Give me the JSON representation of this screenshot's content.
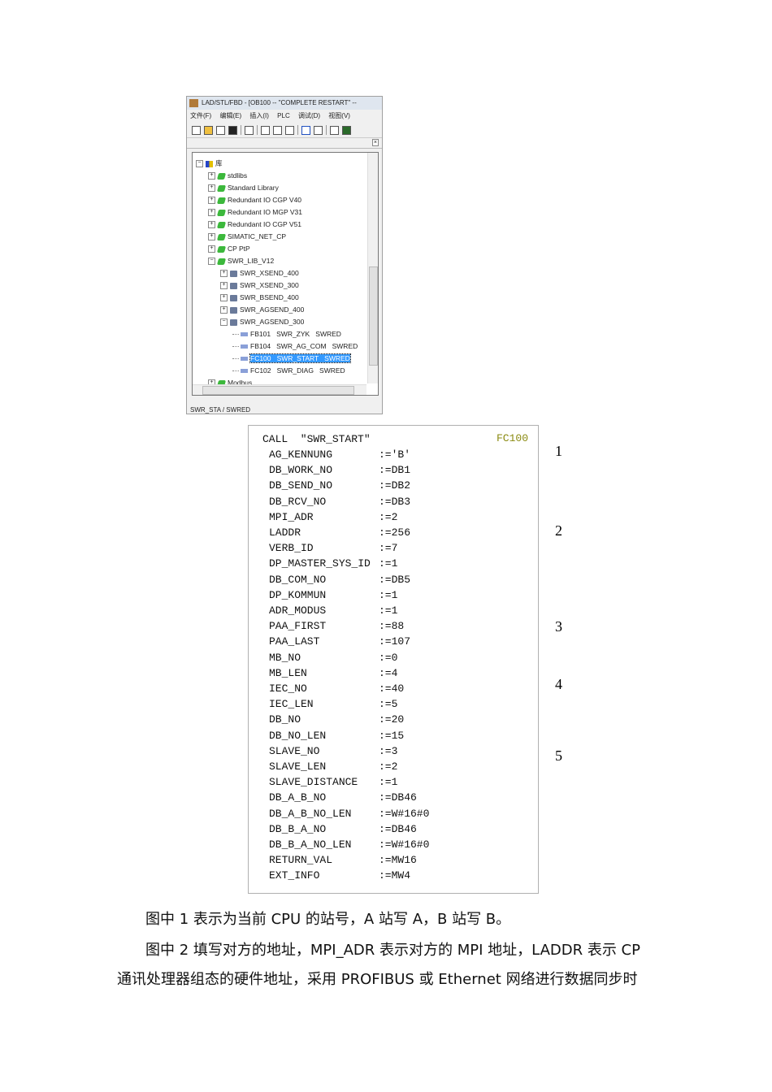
{
  "screenshot": {
    "title": "LAD/STL/FBD  - [OB100 -- \"COMPLETE RESTART\" --",
    "menu": [
      "文件(F)",
      "编辑(E)",
      "插入(I)",
      "PLC",
      "调试(D)",
      "视图(V)"
    ],
    "tree": [
      {
        "label": "库",
        "depth": 0,
        "icon": "book",
        "exp": "−"
      },
      {
        "label": "stdlibs",
        "depth": 1,
        "icon": "lib",
        "exp": "+"
      },
      {
        "label": "Standard Library",
        "depth": 1,
        "icon": "lib",
        "exp": "+"
      },
      {
        "label": "Redundant IO CGP V40",
        "depth": 1,
        "icon": "lib",
        "exp": "+"
      },
      {
        "label": "Redundant IO MGP V31",
        "depth": 1,
        "icon": "lib",
        "exp": "+"
      },
      {
        "label": "Redundant IO CGP V51",
        "depth": 1,
        "icon": "lib",
        "exp": "+"
      },
      {
        "label": "SIMATIC_NET_CP",
        "depth": 1,
        "icon": "lib",
        "exp": "+"
      },
      {
        "label": "CP PtP",
        "depth": 1,
        "icon": "lib",
        "exp": "+"
      },
      {
        "label": "SWR_LIB_V12",
        "depth": 1,
        "icon": "lib",
        "exp": "−"
      },
      {
        "label": "SWR_XSEND_400",
        "depth": 2,
        "icon": "folder",
        "exp": "+"
      },
      {
        "label": "SWR_XSEND_300",
        "depth": 2,
        "icon": "folder",
        "exp": "+"
      },
      {
        "label": "SWR_BSEND_400",
        "depth": 2,
        "icon": "folder",
        "exp": "+"
      },
      {
        "label": "SWR_AGSEND_400",
        "depth": 2,
        "icon": "folder",
        "exp": "+"
      },
      {
        "label": "SWR_AGSEND_300",
        "depth": 2,
        "icon": "folder",
        "exp": "−"
      },
      {
        "label": "FB101   SWR_ZYK   SWRED",
        "depth": 3,
        "icon": "block",
        "exp": ""
      },
      {
        "label": "FB104   SWR_AG_COM   SWRED",
        "depth": 3,
        "icon": "block",
        "exp": ""
      },
      {
        "label": "FC100   SWR_START   SWRED",
        "depth": 3,
        "icon": "block",
        "exp": "",
        "selected": true
      },
      {
        "label": "FC102   SWR_DIAG   SWRED",
        "depth": 3,
        "icon": "block",
        "exp": ""
      },
      {
        "label": "Modbus",
        "depth": 1,
        "icon": "lib",
        "exp": "+"
      }
    ],
    "status": "SWR_STA / SWRED"
  },
  "code": {
    "call": "CALL  \"SWR_START\"",
    "block": "FC100",
    "params": [
      [
        "AG_KENNUNG",
        ":='B'"
      ],
      [
        "DB_WORK_NO",
        ":=DB1"
      ],
      [
        "DB_SEND_NO",
        ":=DB2"
      ],
      [
        "DB_RCV_NO",
        ":=DB3"
      ],
      [
        "MPI_ADR",
        ":=2"
      ],
      [
        "LADDR",
        ":=256"
      ],
      [
        "VERB_ID",
        ":=7"
      ],
      [
        "DP_MASTER_SYS_ID",
        ":=1"
      ],
      [
        "DB_COM_NO",
        ":=DB5"
      ],
      [
        "DP_KOMMUN",
        ":=1"
      ],
      [
        "ADR_MODUS",
        ":=1"
      ],
      [
        "PAA_FIRST",
        ":=88"
      ],
      [
        "PAA_LAST",
        ":=107"
      ],
      [
        "MB_NO",
        ":=0"
      ],
      [
        "MB_LEN",
        ":=4"
      ],
      [
        "IEC_NO",
        ":=40"
      ],
      [
        "IEC_LEN",
        ":=5"
      ],
      [
        "DB_NO",
        ":=20"
      ],
      [
        "DB_NO_LEN",
        ":=15"
      ],
      [
        "SLAVE_NO",
        ":=3"
      ],
      [
        "SLAVE_LEN",
        ":=2"
      ],
      [
        "SLAVE_DISTANCE",
        ":=1"
      ],
      [
        "DB_A_B_NO",
        ":=DB46"
      ],
      [
        "DB_A_B_NO_LEN",
        ":=W#16#0"
      ],
      [
        "DB_B_A_NO",
        ":=DB46"
      ],
      [
        "DB_B_A_NO_LEN",
        ":=W#16#0"
      ],
      [
        "RETURN_VAL",
        ":=MW16"
      ],
      [
        "EXT_INFO",
        ":=MW4"
      ]
    ]
  },
  "markers": [
    "1",
    "2",
    "3",
    "4",
    "5"
  ],
  "paragraphs": [
    "图中 1 表示为当前 CPU 的站号，A 站写 A，B 站写 B。",
    "图中 2 填写对方的地址，MPI_ADR 表示对方的 MPI 地址，LADDR 表示 CP",
    "通讯处理器组态的硬件地址，采用 PROFIBUS 或 Ethernet 网络进行数据同步时"
  ]
}
